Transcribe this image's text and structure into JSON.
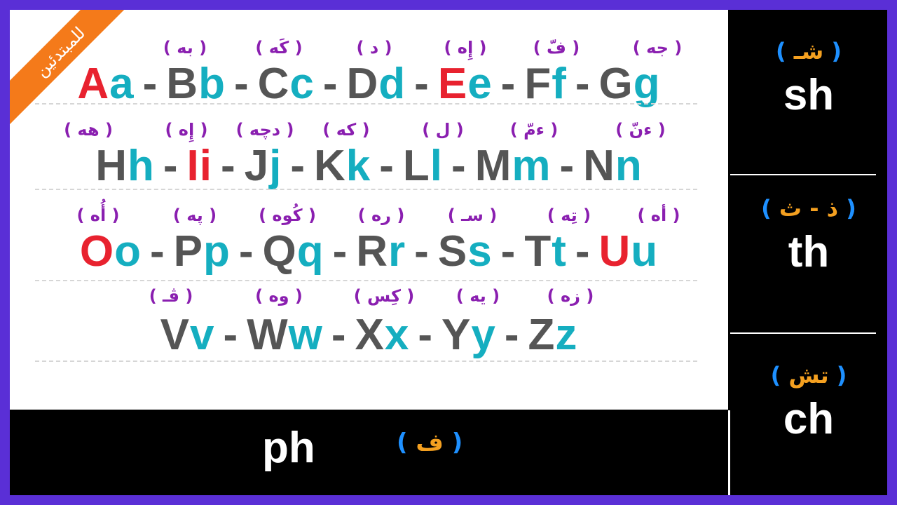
{
  "ribbon_text": "للمبتدئين",
  "rows": [
    {
      "pronunciations": [
        "( به )",
        "( كَه )",
        "( د )",
        "( إِه )",
        "( فّ )",
        "( جه )"
      ],
      "letters": [
        {
          "upper": "A",
          "lower": "a",
          "upper_color": "red",
          "lower_color": "teal"
        },
        {
          "upper": "B",
          "lower": "b",
          "upper_color": "gray",
          "lower_color": "teal"
        },
        {
          "upper": "C",
          "lower": "c",
          "upper_color": "gray",
          "lower_color": "teal"
        },
        {
          "upper": "D",
          "lower": "d",
          "upper_color": "gray",
          "lower_color": "teal"
        },
        {
          "upper": "E",
          "lower": "e",
          "upper_color": "red",
          "lower_color": "teal"
        },
        {
          "upper": "F",
          "lower": "f",
          "upper_color": "gray",
          "lower_color": "teal"
        },
        {
          "upper": "G",
          "lower": "g",
          "upper_color": "gray",
          "lower_color": "teal"
        }
      ]
    },
    {
      "pronunciations": [
        "( هه )",
        "( إِه )",
        "( دچه )",
        "( كه )",
        "( ل )",
        "( ءمّ )",
        "( ءنّ )"
      ],
      "letters": [
        {
          "upper": "H",
          "lower": "h",
          "upper_color": "gray",
          "lower_color": "teal"
        },
        {
          "upper": "I",
          "lower": "i",
          "upper_color": "red",
          "lower_color": "red"
        },
        {
          "upper": "J",
          "lower": "j",
          "upper_color": "gray",
          "lower_color": "teal"
        },
        {
          "upper": "K",
          "lower": "k",
          "upper_color": "gray",
          "lower_color": "teal"
        },
        {
          "upper": "L",
          "lower": "l",
          "upper_color": "gray",
          "lower_color": "teal"
        },
        {
          "upper": "M",
          "lower": "m",
          "upper_color": "gray",
          "lower_color": "teal"
        },
        {
          "upper": "N",
          "lower": "n",
          "upper_color": "gray",
          "lower_color": "teal"
        }
      ]
    },
    {
      "pronunciations": [
        "( أُه )",
        "( په )",
        "( كُوه )",
        "( ره )",
        "( سـ )",
        "( تِه )",
        "( أه )"
      ],
      "letters": [
        {
          "upper": "O",
          "lower": "o",
          "upper_color": "red",
          "lower_color": "teal"
        },
        {
          "upper": "P",
          "lower": "p",
          "upper_color": "gray",
          "lower_color": "teal"
        },
        {
          "upper": "Q",
          "lower": "q",
          "upper_color": "gray",
          "lower_color": "teal"
        },
        {
          "upper": "R",
          "lower": "r",
          "upper_color": "gray",
          "lower_color": "teal"
        },
        {
          "upper": "S",
          "lower": "s",
          "upper_color": "gray",
          "lower_color": "teal"
        },
        {
          "upper": "T",
          "lower": "t",
          "upper_color": "gray",
          "lower_color": "teal"
        },
        {
          "upper": "U",
          "lower": "u",
          "upper_color": "red",
          "lower_color": "teal"
        }
      ]
    },
    {
      "pronunciations": [
        "( ڤـ )",
        "( وه )",
        "( كِس )",
        "( يه )",
        "( زه )"
      ],
      "letters": [
        {
          "upper": "V",
          "lower": "v",
          "upper_color": "gray",
          "lower_color": "teal"
        },
        {
          "upper": "W",
          "lower": "w",
          "upper_color": "gray",
          "lower_color": "teal"
        },
        {
          "upper": "X",
          "lower": "x",
          "upper_color": "gray",
          "lower_color": "teal"
        },
        {
          "upper": "Y",
          "lower": "y",
          "upper_color": "gray",
          "lower_color": "teal"
        },
        {
          "upper": "Z",
          "lower": "z",
          "upper_color": "gray",
          "lower_color": "teal"
        }
      ]
    }
  ],
  "separator": "-",
  "digraphs": {
    "ph": {
      "letters": "ph",
      "pron": "ف"
    },
    "sh": {
      "letters": "sh",
      "pron": "شـ"
    },
    "th": {
      "letters": "th",
      "pron": "ذ - ث"
    },
    "ch": {
      "letters": "ch",
      "pron": "تش"
    }
  },
  "paren_open": "(",
  "paren_close": ")",
  "colors": {
    "background": "#5a2fd6",
    "red": "#e8222f",
    "teal": "#15aec0",
    "gray": "#555555",
    "purple": "#8a1fb0",
    "orange": "#f47a1a",
    "blue_paren": "#1e90ff",
    "arabic_orange": "#f4a020"
  }
}
